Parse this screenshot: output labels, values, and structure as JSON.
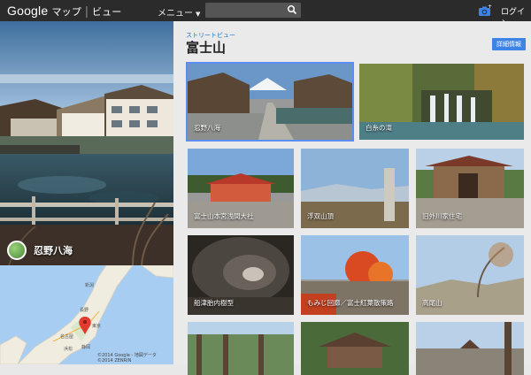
{
  "topbar": {
    "logo_google": "Google",
    "logo_maps": "マップ",
    "logo_sep": "|",
    "logo_view": "ビュー",
    "menu_label": "メニュー",
    "search_value": "",
    "login_label": "ログイン"
  },
  "left_panel": {
    "place_name": "忍野八海",
    "map_credit": "©2014 Google - 地図データ ©2014 ZENRIN"
  },
  "map_labels": [
    "新潟",
    "長野",
    "名古屋",
    "東京",
    "静岡",
    "浜松"
  ],
  "right_panel": {
    "kicker": "ストリートビュー",
    "title": "富士山",
    "info_button": "詳細情報",
    "tiles": [
      {
        "label": "忍野八海",
        "selected": true
      },
      {
        "label": "白糸の滝"
      },
      {
        "label": "富士山本宮浅間大社"
      },
      {
        "label": "浮双山頂"
      },
      {
        "label": "旧外川家住宅"
      },
      {
        "label": "船津胎内樹型"
      },
      {
        "label": "もみじ回廊／富士紅葉散策路"
      },
      {
        "label": "高尾山"
      },
      {
        "label": ""
      },
      {
        "label": ""
      },
      {
        "label": ""
      }
    ]
  },
  "colors": {
    "topbar": "#2b2b2b",
    "accent": "#3d84e6",
    "panel_bg": "#eaeaea",
    "selected_border": "#5b8ef0"
  }
}
